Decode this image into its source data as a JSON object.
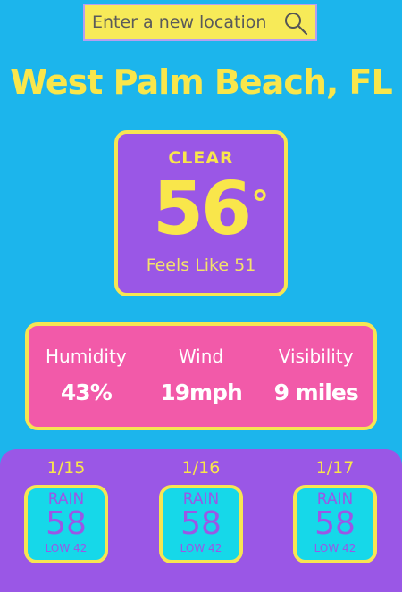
{
  "search": {
    "placeholder": "Enter a new location"
  },
  "location": {
    "name": "West Palm Beach, FL"
  },
  "current": {
    "condition": "CLEAR",
    "temp": "56",
    "feels_like": "Feels Like 51"
  },
  "stats": [
    {
      "label": "Humidity",
      "value": "43%"
    },
    {
      "label": "Wind",
      "value": "19mph"
    },
    {
      "label": "Visibility",
      "value": "9 miles"
    }
  ],
  "forecast": [
    {
      "date": "1/15",
      "condition": "RAIN",
      "high": "58",
      "low": "LOW 42"
    },
    {
      "date": "1/16",
      "condition": "RAIN",
      "high": "58",
      "low": "LOW 42"
    },
    {
      "date": "1/17",
      "condition": "RAIN",
      "high": "58",
      "low": "LOW 42"
    }
  ],
  "colors": {
    "background": "#1cb5ec",
    "yellow": "#f9e64b",
    "purple": "#9a57e6",
    "pink": "#f25aa9",
    "cyan": "#16d8e9"
  },
  "icons": {
    "search": "search-icon"
  }
}
